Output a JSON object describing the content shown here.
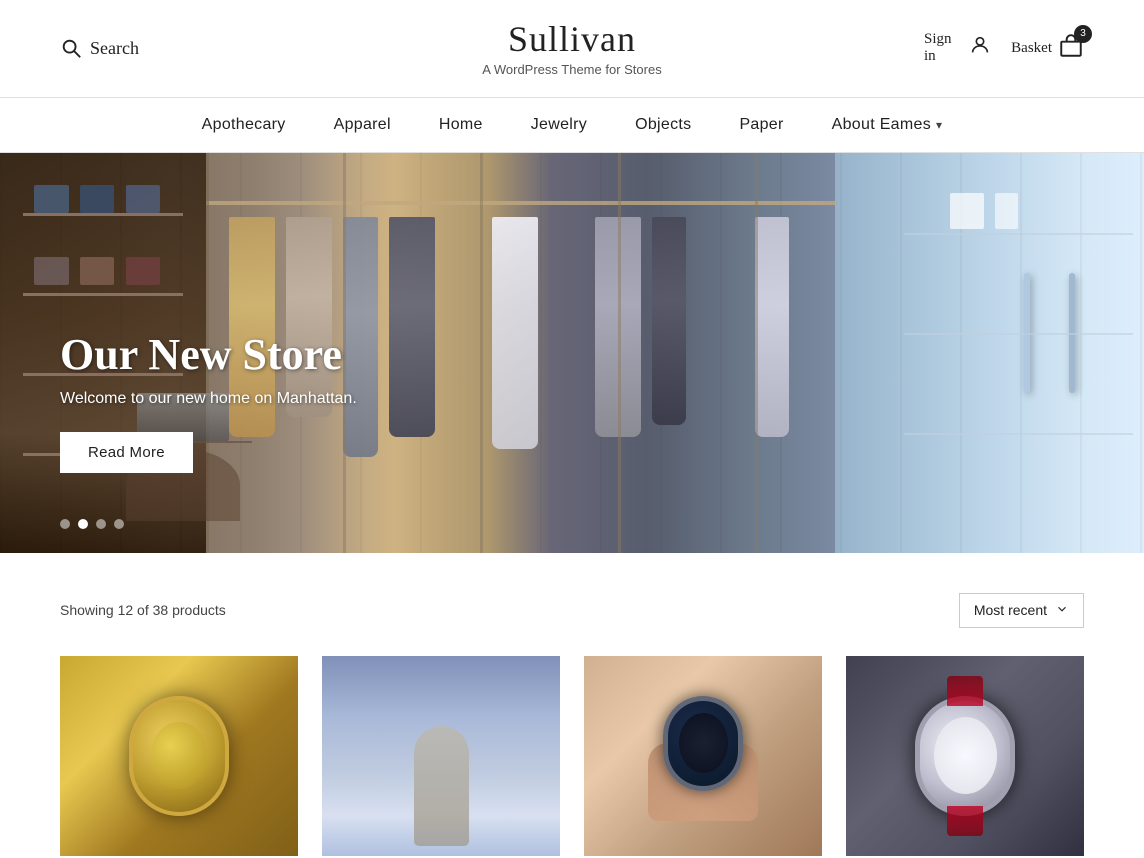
{
  "header": {
    "search_label": "Search",
    "brand_title": "Sullivan",
    "brand_subtitle": "A WordPress Theme for Stores",
    "signin_label": "Sign in",
    "basket_label": "Basket",
    "basket_count": "3"
  },
  "nav": {
    "items": [
      {
        "label": "Apothecary",
        "has_dropdown": false
      },
      {
        "label": "Apparel",
        "has_dropdown": false
      },
      {
        "label": "Home",
        "has_dropdown": false
      },
      {
        "label": "Jewelry",
        "has_dropdown": false
      },
      {
        "label": "Objects",
        "has_dropdown": false
      },
      {
        "label": "Paper",
        "has_dropdown": false
      },
      {
        "label": "About Eames",
        "has_dropdown": true
      }
    ]
  },
  "hero": {
    "title": "Our New Store",
    "subtitle": "Welcome to our new home on Manhattan.",
    "cta_label": "Read More",
    "dots": [
      {
        "active": false
      },
      {
        "active": true
      },
      {
        "active": false
      },
      {
        "active": false
      }
    ]
  },
  "products": {
    "count_text": "Showing 12 of 38 products",
    "sort_label": "Most recent",
    "sort_icon": "chevron-down"
  },
  "icons": {
    "search": "🔍",
    "user": "👤",
    "basket": "🛒",
    "chevron_down": "▾"
  }
}
